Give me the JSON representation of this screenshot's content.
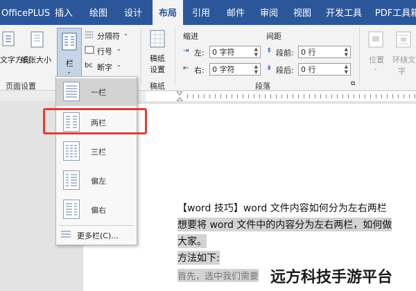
{
  "tabs": [
    {
      "label": "OfficePLUS"
    },
    {
      "label": "插入"
    },
    {
      "label": "绘图"
    },
    {
      "label": "设计"
    },
    {
      "label": "布局"
    },
    {
      "label": "引用"
    },
    {
      "label": "邮件"
    },
    {
      "label": "审阅"
    },
    {
      "label": "视图"
    },
    {
      "label": "开发工具"
    },
    {
      "label": "PDF工具箱"
    }
  ],
  "ribbon": {
    "orientation": "文字方向",
    "paper_size": "纸张大小",
    "columns": "栏",
    "breaks": "分隔符",
    "line_numbers": "行号",
    "hyphenation": "断字",
    "group_page_setup": "页面设置",
    "manuscript_line1": "稿纸",
    "manuscript_line2": "设置",
    "group_manuscript": "稿纸",
    "indent_title": "缩进",
    "indent_left_label": "左:",
    "indent_left_value": "0 字符",
    "indent_right_label": "右:",
    "indent_right_value": "0 字符",
    "spacing_title": "间距",
    "spacing_before_label": "段前:",
    "spacing_before_value": "0 行",
    "spacing_after_label": "段后:",
    "spacing_after_value": "0 行",
    "group_paragraph": "段落",
    "position": "位置",
    "wrap_text_line1": "环绕文",
    "wrap_text_line2": "字"
  },
  "columns_menu": {
    "items": [
      {
        "label": "一栏"
      },
      {
        "label": "两栏"
      },
      {
        "label": "三栏"
      },
      {
        "label": "偏左"
      },
      {
        "label": "偏右"
      }
    ],
    "more": "更多栏(C)..."
  },
  "document": {
    "line1": "【word 技巧】word 文件内容如何分为左右两栏",
    "line2": "想要将 word 文件中的内容分为左右两栏，如何做",
    "line3": "大家。",
    "line4": "方法如下:",
    "line5": "首先，选中我们需要"
  },
  "watermark": "远方科技手游平台",
  "colors": {
    "ribbon_tab": "#2b579a",
    "highlight_box": "#e53935"
  }
}
